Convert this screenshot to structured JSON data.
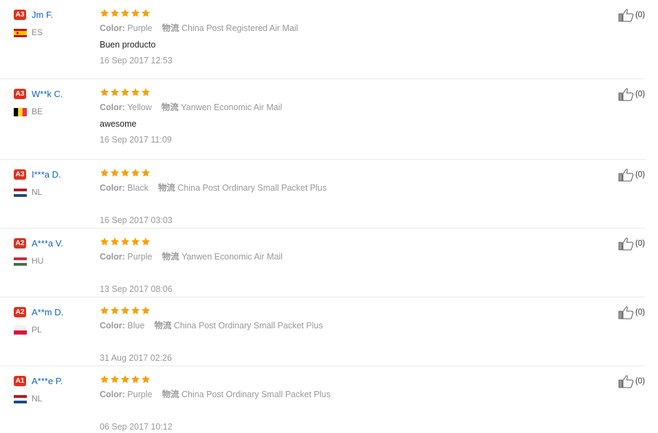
{
  "labels": {
    "color_key": "Color:",
    "shipping_key": "物流"
  },
  "colors": {
    "badge": "#e0301e",
    "username": "#0b64c0",
    "star": "#f6a10b",
    "muted": "#999999"
  },
  "reviews": [
    {
      "level": "A3",
      "name": "Jm F.",
      "country": "ES",
      "flag": "spain",
      "rating": 5,
      "color": "Purple",
      "shipping": "China Post Registered Air Mail",
      "text": "Buen producto",
      "date": "16 Sep 2017 12:53",
      "helpful": "(0)"
    },
    {
      "level": "A3",
      "name": "W**k C.",
      "country": "BE",
      "flag": "belgium",
      "rating": 5,
      "color": "Yellow",
      "shipping": "Yanwen Economic Air Mail",
      "text": "awesome",
      "date": "16 Sep 2017 11:09",
      "helpful": "(0)"
    },
    {
      "level": "A3",
      "name": "I***a D.",
      "country": "NL",
      "flag": "netherlands",
      "rating": 5,
      "color": "Black",
      "shipping": "China Post Ordinary Small Packet Plus",
      "text": "",
      "date": "16 Sep 2017 03:03",
      "helpful": "(0)"
    },
    {
      "level": "A2",
      "name": "A***a V.",
      "country": "HU",
      "flag": "hungary",
      "rating": 5,
      "color": "Purple",
      "shipping": "Yanwen Economic Air Mail",
      "text": "",
      "date": "13 Sep 2017 08:06",
      "helpful": "(0)"
    },
    {
      "level": "A2",
      "name": "A**m D.",
      "country": "PL",
      "flag": "poland",
      "rating": 5,
      "color": "Blue",
      "shipping": "China Post Ordinary Small Packet Plus",
      "text": "",
      "date": "31 Aug 2017 02:26",
      "helpful": "(0)"
    },
    {
      "level": "A1",
      "name": "A***e P.",
      "country": "NL",
      "flag": "netherlands",
      "rating": 5,
      "color": "Purple",
      "shipping": "China Post Ordinary Small Packet Plus",
      "text": "",
      "date": "06 Sep 2017 10:12",
      "helpful": "(0)"
    }
  ]
}
